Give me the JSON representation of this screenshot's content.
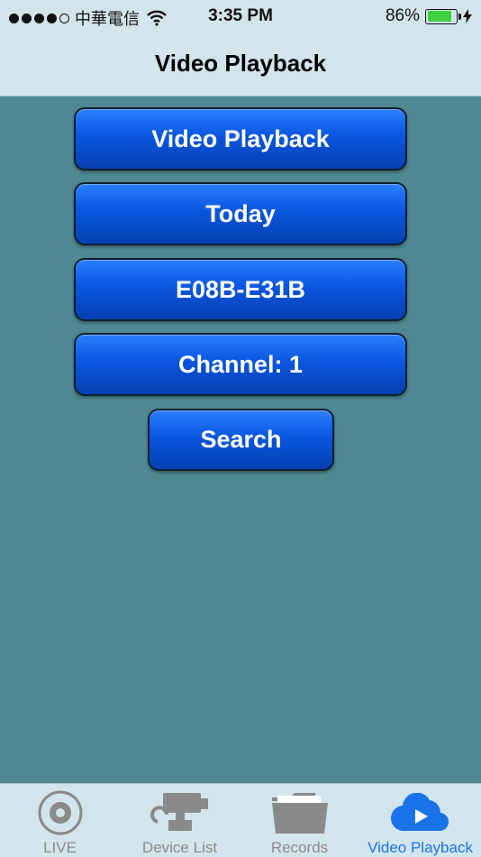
{
  "status_bar": {
    "carrier": "中華電信",
    "time": "3:35 PM",
    "battery": "86%",
    "battery_level": 0.86
  },
  "nav": {
    "title": "Video Playback"
  },
  "buttons": {
    "video_playback": "Video Playback",
    "date": "Today",
    "range": "E08B-E31B",
    "channel": "Channel:  1",
    "search": "Search"
  },
  "tabs": [
    {
      "label": "LIVE",
      "icon": "live-icon",
      "active": false
    },
    {
      "label": "Device List",
      "icon": "camera-icon",
      "active": false
    },
    {
      "label": "Records",
      "icon": "folder-icon",
      "active": false
    },
    {
      "label": "Video Playback",
      "icon": "cloud-play-icon",
      "active": true
    }
  ],
  "colors": {
    "background": "#4f8892",
    "bar": "#d3e5ec",
    "button": "#0a56e0",
    "active_tab": "#1a73e8"
  }
}
